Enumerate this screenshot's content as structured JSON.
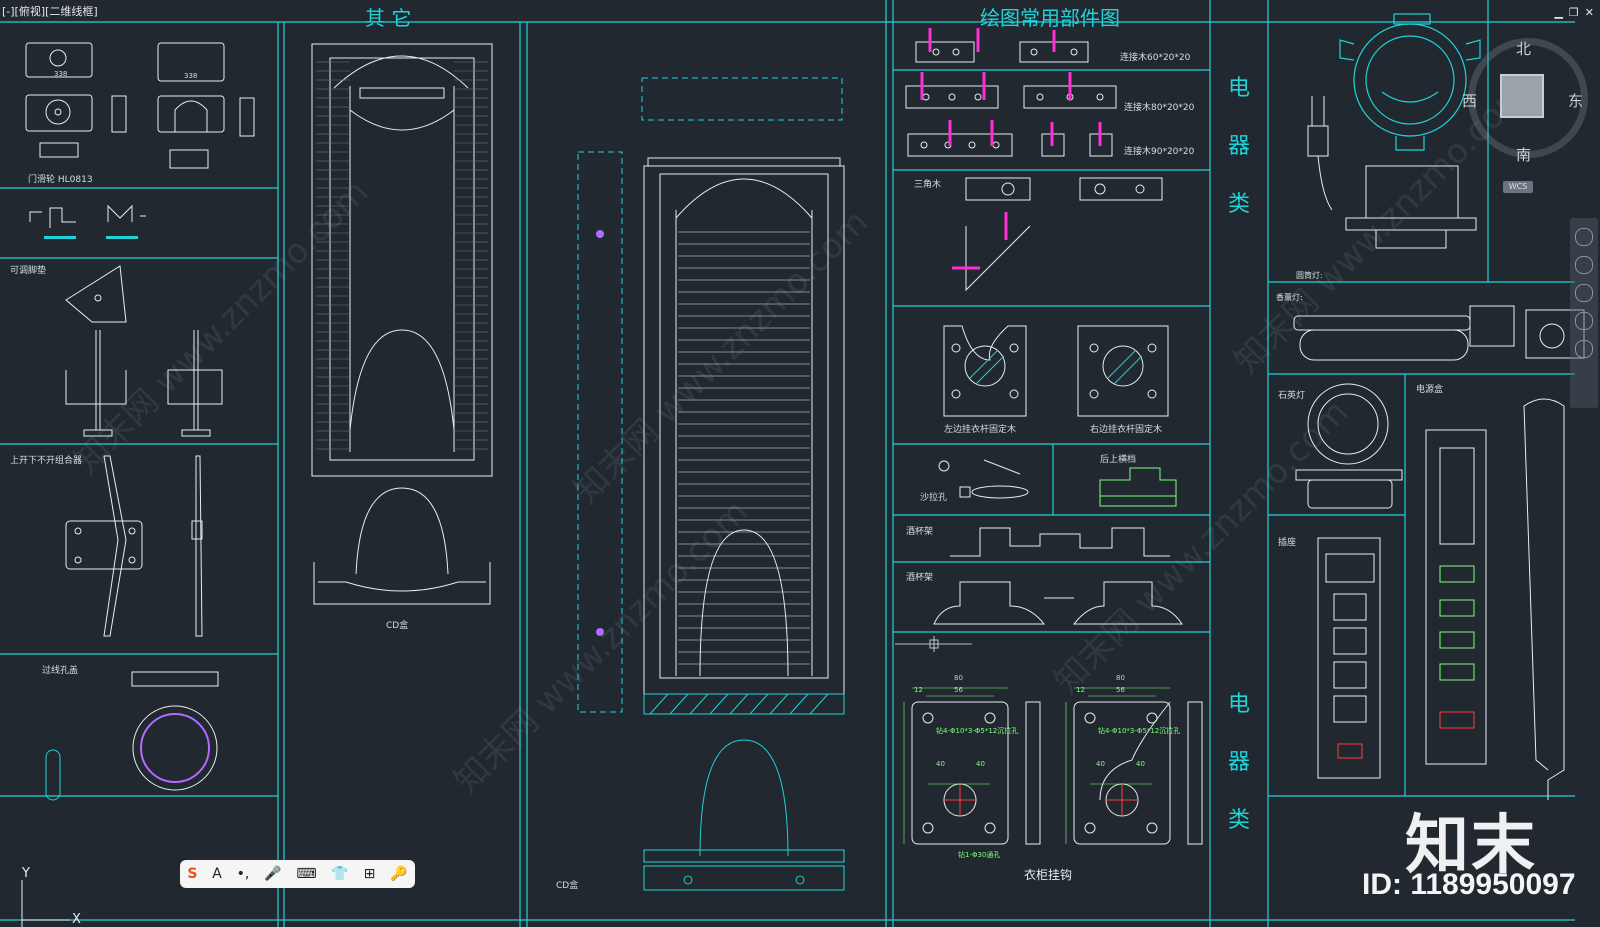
{
  "viewport": {
    "label": "[-][俯视][二维线框]"
  },
  "window_controls": {
    "minimize": "▁",
    "restore": "❐",
    "close": "✕"
  },
  "headers": {
    "other": "其   它",
    "common_parts": "绘图常用部件图",
    "electric_1": "电\n器\n类",
    "electric_2": "电\n器\n类"
  },
  "labels": {
    "door_pulley": "门滑轮 HL0813",
    "pulley_num1": "338",
    "pulley_num2": "338",
    "adjustable_foot": "可调脚垫",
    "combo": "上开下不开组合器",
    "cable_cover": "过线孔盖",
    "cd_box_1": "CD盒",
    "cd_box_2": "CD盒",
    "conn_60": "连接木60*20*20",
    "conn_80": "连接木80*20*20",
    "conn_90": "连接木90*20*20",
    "triangle_wood": "三角木",
    "left_rod": "左边挂衣杆固定木",
    "right_rod": "右边挂衣杆固定木",
    "sofa_hole": "沙拉孔",
    "back_rail": "后上横档",
    "wine_rack_1": "酒杯架",
    "wine_rack_2": "酒杯架",
    "wardrobe_hook": "衣柜挂钩",
    "dim_80a": "80",
    "dim_56a": "56",
    "dim_12a": "12",
    "dim_40a": "40",
    "dim_40b": "40",
    "dim_80b": "80",
    "dim_56b": "56",
    "dim_12b": "12",
    "dim_40c": "40",
    "dim_40d": "40",
    "drill_note_1": "钻4-Φ10*3-Φ5*12沉拉孔",
    "drill_note_2": "钻4-Φ10*3-Φ5*12沉拉孔",
    "drill_note_3": "钻1-Φ30通孔",
    "round_lamp": "圆筒灯:",
    "fragrance_lamp": "香薰灯:",
    "quartz_lamp": "石英灯",
    "power_box": "电源盒",
    "socket": "插座"
  },
  "viewcube": {
    "north": "北",
    "south": "南",
    "east": "东",
    "west": "西",
    "wcs": "WCS"
  },
  "axis": {
    "y": "Y",
    "x": "X"
  },
  "toolbar": {
    "items": [
      "S",
      "A",
      "•,",
      "🎤",
      "⌨",
      "👕",
      "⊞",
      "🔑"
    ]
  },
  "watermark": {
    "brand": "知末",
    "id": "ID: 1189950097",
    "diag": "知末网 www.znzmo.com"
  },
  "colors": {
    "bg": "#212830",
    "cyan": "#1fd3d8",
    "white": "#e8ecef",
    "magenta": "#ff2dd2",
    "green": "#7cff7c",
    "red": "#ff3b3b"
  }
}
